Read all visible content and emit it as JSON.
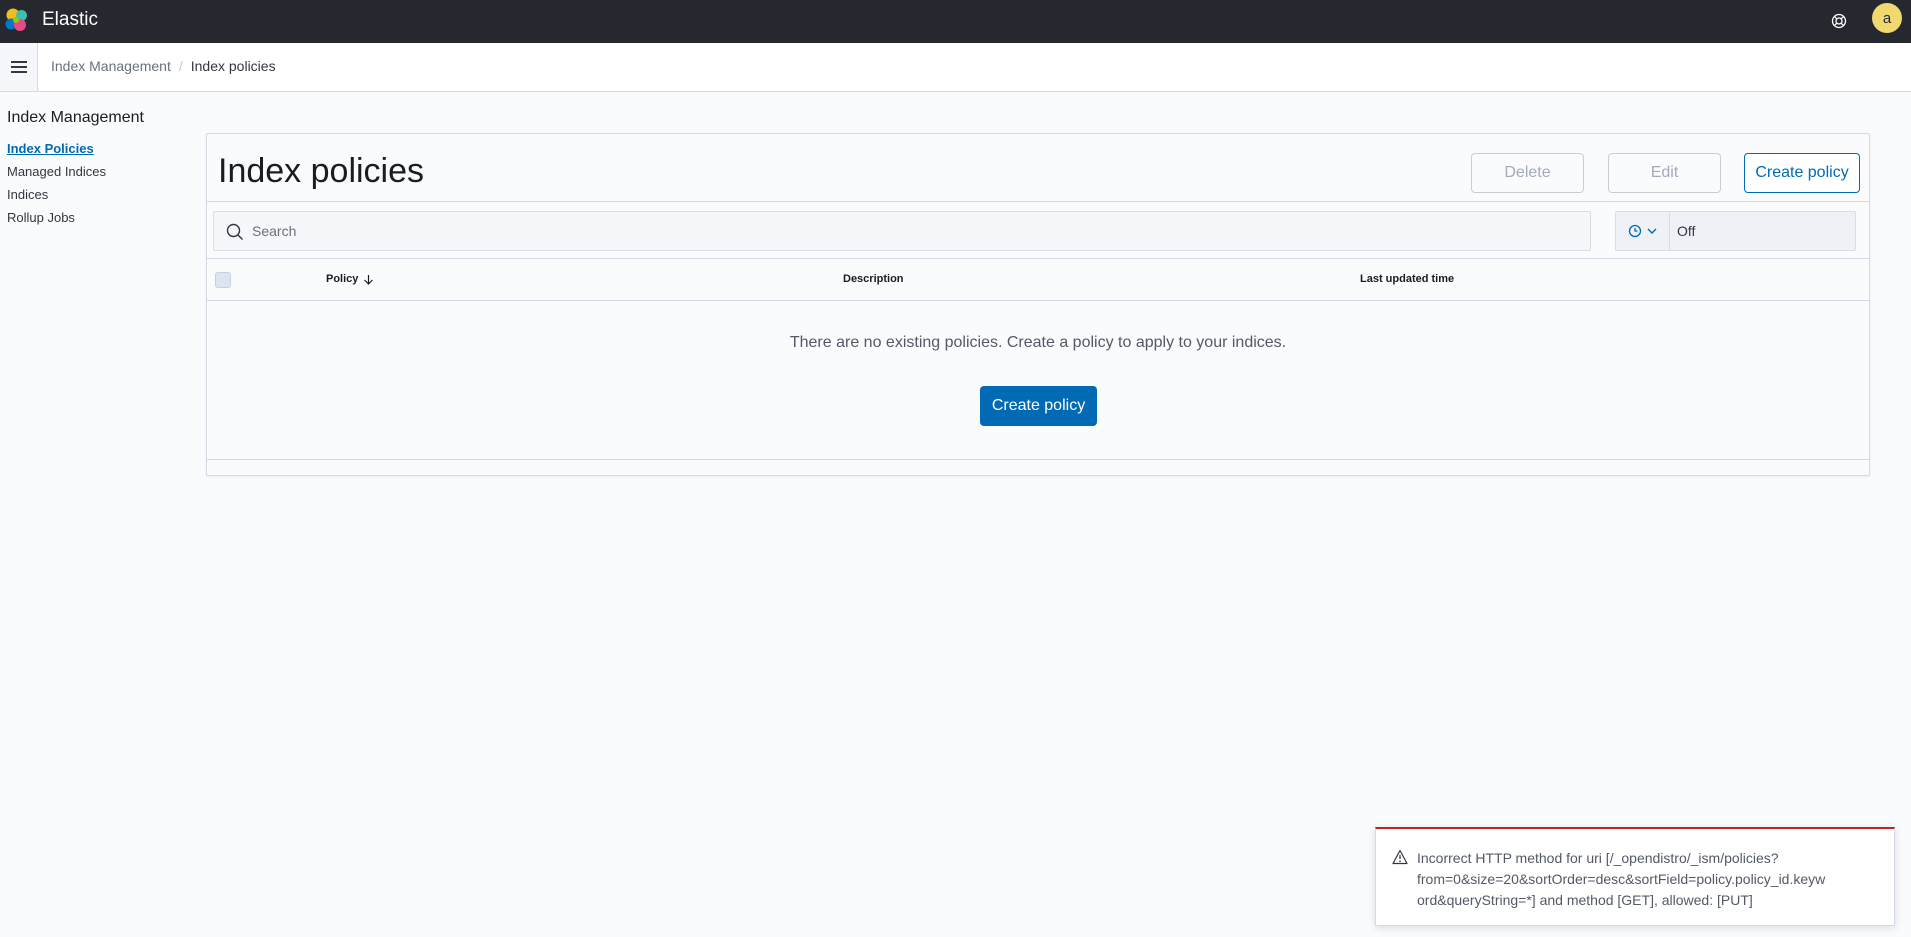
{
  "header": {
    "app_title": "Elastic",
    "avatar_initial": "a"
  },
  "breadcrumbs": {
    "parent": "Index Management",
    "separator": "/",
    "current": "Index policies"
  },
  "sidenav": {
    "title": "Index Management",
    "items": [
      {
        "label": "Index Policies",
        "active": true
      },
      {
        "label": "Managed Indices",
        "active": false
      },
      {
        "label": "Indices",
        "active": false
      },
      {
        "label": "Rollup Jobs",
        "active": false
      }
    ]
  },
  "panel": {
    "title": "Index policies",
    "delete_label": "Delete",
    "edit_label": "Edit",
    "create_label": "Create policy"
  },
  "search": {
    "placeholder": "Search",
    "value": ""
  },
  "refresh": {
    "value": "Off"
  },
  "table": {
    "columns": [
      "Policy",
      "Description",
      "Last updated time"
    ],
    "empty_message": "There are no existing policies. Create a policy to apply to your indices.",
    "empty_action_label": "Create policy"
  },
  "toast": {
    "lines": [
      "Incorrect HTTP method for uri [/_opendistro/_ism/policies?",
      "from=0&size=20&sortOrder=desc&sortField=policy.policy_id.keyw",
      "ord&queryString=*] and method [GET], allowed: [PUT]"
    ]
  },
  "colors": {
    "header_bg": "#25282f",
    "primary": "#006bb4",
    "avatar_bg": "#f1d86f",
    "danger": "#bd271e"
  }
}
